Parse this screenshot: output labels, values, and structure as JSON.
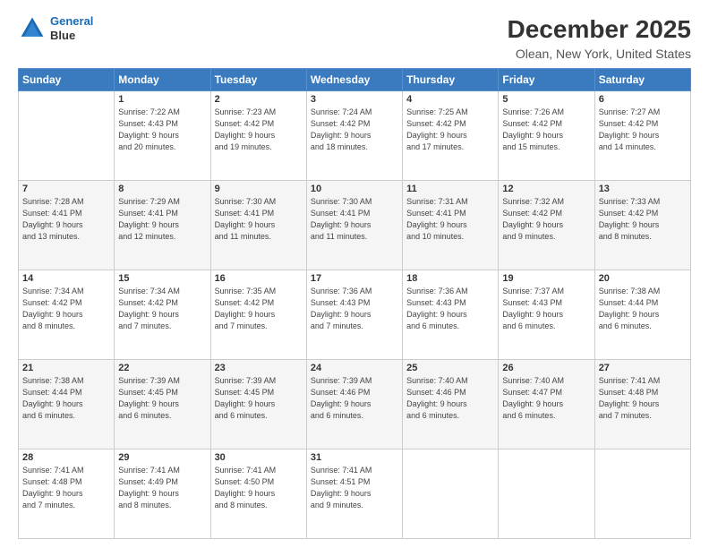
{
  "header": {
    "logo_line1": "General",
    "logo_line2": "Blue",
    "title": "December 2025",
    "subtitle": "Olean, New York, United States"
  },
  "columns": [
    "Sunday",
    "Monday",
    "Tuesday",
    "Wednesday",
    "Thursday",
    "Friday",
    "Saturday"
  ],
  "weeks": [
    [
      {
        "num": "",
        "info": ""
      },
      {
        "num": "1",
        "info": "Sunrise: 7:22 AM\nSunset: 4:43 PM\nDaylight: 9 hours\nand 20 minutes."
      },
      {
        "num": "2",
        "info": "Sunrise: 7:23 AM\nSunset: 4:42 PM\nDaylight: 9 hours\nand 19 minutes."
      },
      {
        "num": "3",
        "info": "Sunrise: 7:24 AM\nSunset: 4:42 PM\nDaylight: 9 hours\nand 18 minutes."
      },
      {
        "num": "4",
        "info": "Sunrise: 7:25 AM\nSunset: 4:42 PM\nDaylight: 9 hours\nand 17 minutes."
      },
      {
        "num": "5",
        "info": "Sunrise: 7:26 AM\nSunset: 4:42 PM\nDaylight: 9 hours\nand 15 minutes."
      },
      {
        "num": "6",
        "info": "Sunrise: 7:27 AM\nSunset: 4:42 PM\nDaylight: 9 hours\nand 14 minutes."
      }
    ],
    [
      {
        "num": "7",
        "info": "Sunrise: 7:28 AM\nSunset: 4:41 PM\nDaylight: 9 hours\nand 13 minutes."
      },
      {
        "num": "8",
        "info": "Sunrise: 7:29 AM\nSunset: 4:41 PM\nDaylight: 9 hours\nand 12 minutes."
      },
      {
        "num": "9",
        "info": "Sunrise: 7:30 AM\nSunset: 4:41 PM\nDaylight: 9 hours\nand 11 minutes."
      },
      {
        "num": "10",
        "info": "Sunrise: 7:30 AM\nSunset: 4:41 PM\nDaylight: 9 hours\nand 11 minutes."
      },
      {
        "num": "11",
        "info": "Sunrise: 7:31 AM\nSunset: 4:41 PM\nDaylight: 9 hours\nand 10 minutes."
      },
      {
        "num": "12",
        "info": "Sunrise: 7:32 AM\nSunset: 4:42 PM\nDaylight: 9 hours\nand 9 minutes."
      },
      {
        "num": "13",
        "info": "Sunrise: 7:33 AM\nSunset: 4:42 PM\nDaylight: 9 hours\nand 8 minutes."
      }
    ],
    [
      {
        "num": "14",
        "info": "Sunrise: 7:34 AM\nSunset: 4:42 PM\nDaylight: 9 hours\nand 8 minutes."
      },
      {
        "num": "15",
        "info": "Sunrise: 7:34 AM\nSunset: 4:42 PM\nDaylight: 9 hours\nand 7 minutes."
      },
      {
        "num": "16",
        "info": "Sunrise: 7:35 AM\nSunset: 4:42 PM\nDaylight: 9 hours\nand 7 minutes."
      },
      {
        "num": "17",
        "info": "Sunrise: 7:36 AM\nSunset: 4:43 PM\nDaylight: 9 hours\nand 7 minutes."
      },
      {
        "num": "18",
        "info": "Sunrise: 7:36 AM\nSunset: 4:43 PM\nDaylight: 9 hours\nand 6 minutes."
      },
      {
        "num": "19",
        "info": "Sunrise: 7:37 AM\nSunset: 4:43 PM\nDaylight: 9 hours\nand 6 minutes."
      },
      {
        "num": "20",
        "info": "Sunrise: 7:38 AM\nSunset: 4:44 PM\nDaylight: 9 hours\nand 6 minutes."
      }
    ],
    [
      {
        "num": "21",
        "info": "Sunrise: 7:38 AM\nSunset: 4:44 PM\nDaylight: 9 hours\nand 6 minutes."
      },
      {
        "num": "22",
        "info": "Sunrise: 7:39 AM\nSunset: 4:45 PM\nDaylight: 9 hours\nand 6 minutes."
      },
      {
        "num": "23",
        "info": "Sunrise: 7:39 AM\nSunset: 4:45 PM\nDaylight: 9 hours\nand 6 minutes."
      },
      {
        "num": "24",
        "info": "Sunrise: 7:39 AM\nSunset: 4:46 PM\nDaylight: 9 hours\nand 6 minutes."
      },
      {
        "num": "25",
        "info": "Sunrise: 7:40 AM\nSunset: 4:46 PM\nDaylight: 9 hours\nand 6 minutes."
      },
      {
        "num": "26",
        "info": "Sunrise: 7:40 AM\nSunset: 4:47 PM\nDaylight: 9 hours\nand 6 minutes."
      },
      {
        "num": "27",
        "info": "Sunrise: 7:41 AM\nSunset: 4:48 PM\nDaylight: 9 hours\nand 7 minutes."
      }
    ],
    [
      {
        "num": "28",
        "info": "Sunrise: 7:41 AM\nSunset: 4:48 PM\nDaylight: 9 hours\nand 7 minutes."
      },
      {
        "num": "29",
        "info": "Sunrise: 7:41 AM\nSunset: 4:49 PM\nDaylight: 9 hours\nand 8 minutes."
      },
      {
        "num": "30",
        "info": "Sunrise: 7:41 AM\nSunset: 4:50 PM\nDaylight: 9 hours\nand 8 minutes."
      },
      {
        "num": "31",
        "info": "Sunrise: 7:41 AM\nSunset: 4:51 PM\nDaylight: 9 hours\nand 9 minutes."
      },
      {
        "num": "",
        "info": ""
      },
      {
        "num": "",
        "info": ""
      },
      {
        "num": "",
        "info": ""
      }
    ]
  ]
}
